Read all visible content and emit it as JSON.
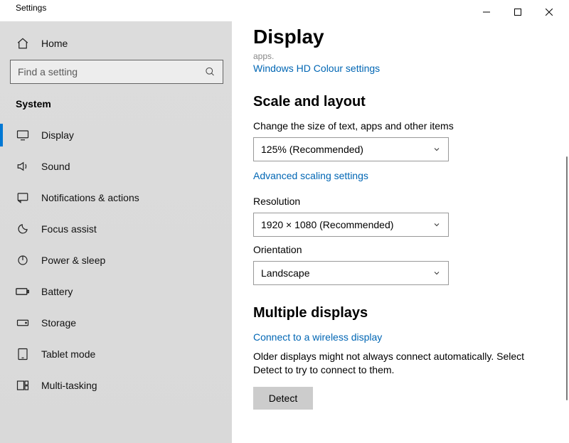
{
  "window": {
    "title": "Settings"
  },
  "sidebar": {
    "home_label": "Home",
    "search_placeholder": "Find a setting",
    "section_label": "System",
    "items": [
      {
        "icon": "display",
        "label": "Display",
        "selected": true
      },
      {
        "icon": "sound",
        "label": "Sound",
        "selected": false
      },
      {
        "icon": "notifications",
        "label": "Notifications & actions",
        "selected": false
      },
      {
        "icon": "focus",
        "label": "Focus assist",
        "selected": false
      },
      {
        "icon": "power",
        "label": "Power & sleep",
        "selected": false
      },
      {
        "icon": "battery",
        "label": "Battery",
        "selected": false
      },
      {
        "icon": "storage",
        "label": "Storage",
        "selected": false
      },
      {
        "icon": "tablet",
        "label": "Tablet mode",
        "selected": false
      },
      {
        "icon": "multitasking",
        "label": "Multi-tasking",
        "selected": false
      }
    ]
  },
  "content": {
    "page_title": "Display",
    "truncated_prev": "apps.",
    "hd_colour_link": "Windows HD Colour settings",
    "scale_heading": "Scale and layout",
    "scale_label": "Change the size of text, apps and other items",
    "scale_value": "125% (Recommended)",
    "advanced_scaling_link": "Advanced scaling settings",
    "resolution_label": "Resolution",
    "resolution_value": "1920 × 1080 (Recommended)",
    "orientation_label": "Orientation",
    "orientation_value": "Landscape",
    "multiple_heading": "Multiple displays",
    "wireless_link": "Connect to a wireless display",
    "detect_help": "Older displays might not always connect automatically. Select Detect to try to connect to them.",
    "detect_button": "Detect"
  }
}
